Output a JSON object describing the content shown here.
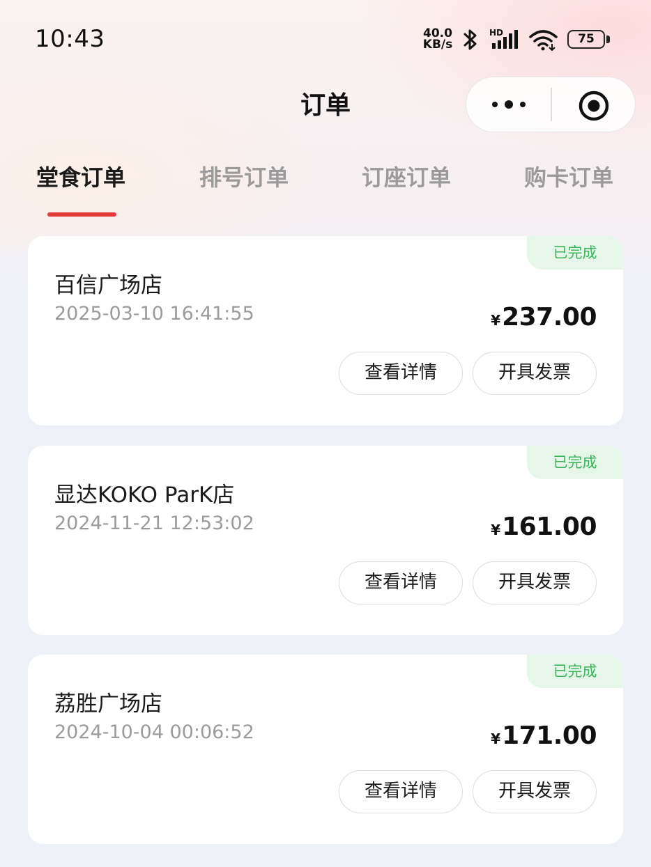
{
  "status_bar": {
    "time": "10:43",
    "net_speed_value": "40.0",
    "net_speed_unit": "KB/s",
    "signal_tag": "HD",
    "battery_level": "75",
    "icons": [
      "bluetooth-icon",
      "signal-icon",
      "wifi-icon",
      "battery-icon"
    ]
  },
  "nav": {
    "title": "订单",
    "more_icon": "more-dots-icon",
    "close_icon": "target-close-icon"
  },
  "tabs": [
    {
      "label": "堂食订单",
      "active": true
    },
    {
      "label": "排号订单",
      "active": false
    },
    {
      "label": "订座订单",
      "active": false
    },
    {
      "label": "购卡订单",
      "active": false
    }
  ],
  "orders": [
    {
      "status": "已完成",
      "store": "百信广场店",
      "time": "2025-03-10 16:41:55",
      "currency": "¥",
      "amount": "237.00",
      "details_label": "查看详情",
      "invoice_label": "开具发票"
    },
    {
      "status": "已完成",
      "store": "显达KOKO ParK店",
      "time": "2024-11-21 12:53:02",
      "currency": "¥",
      "amount": "161.00",
      "details_label": "查看详情",
      "invoice_label": "开具发票"
    },
    {
      "status": "已完成",
      "store": "荔胜广场店",
      "time": "2024-10-04 00:06:52",
      "currency": "¥",
      "amount": "171.00",
      "details_label": "查看详情",
      "invoice_label": "开具发票"
    }
  ],
  "colors": {
    "accent": "#e2393b",
    "status_green": "#3cb55a",
    "status_green_bg": "#e6f7e9"
  }
}
